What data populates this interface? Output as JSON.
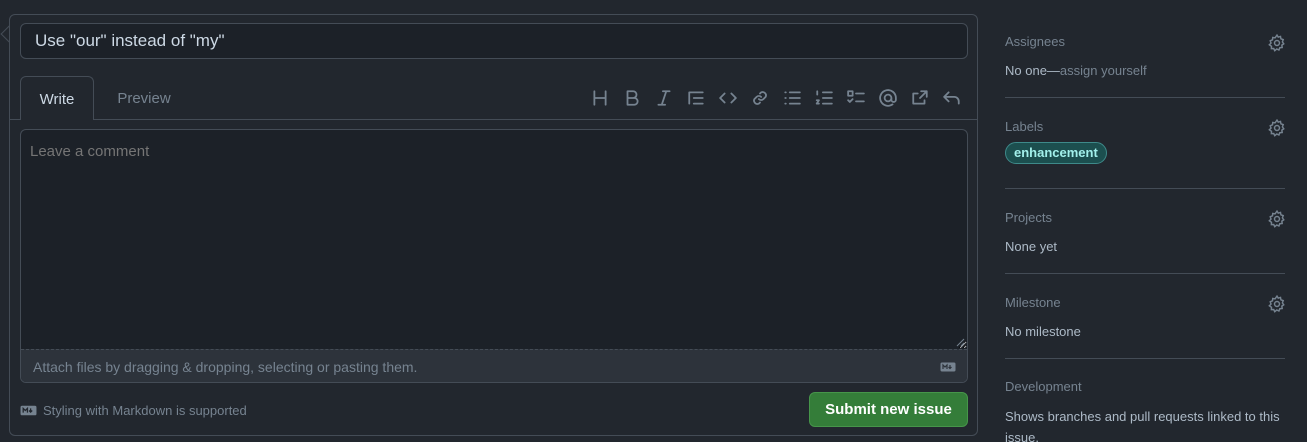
{
  "issue": {
    "title_value": "Use \"our\" instead of \"my\"",
    "tabs": [
      {
        "label": "Write"
      },
      {
        "label": "Preview"
      }
    ],
    "comment_placeholder": "Leave a comment",
    "attach_text": "Attach files by dragging & dropping, selecting or pasting them.",
    "markdown_note": "Styling with Markdown is supported",
    "submit_label": "Submit new issue",
    "toolbar_icons": [
      "heading-icon",
      "bold-icon",
      "italic-icon",
      "quote-icon",
      "code-icon",
      "link-icon",
      "unordered-list-icon",
      "ordered-list-icon",
      "task-list-icon",
      "mention-icon",
      "reference-icon",
      "undo-icon"
    ]
  },
  "sidebar": {
    "assignees": {
      "heading": "Assignees",
      "value_prefix": "No one—",
      "value_link": "assign yourself"
    },
    "labels": {
      "heading": "Labels",
      "items": [
        {
          "name": "enhancement",
          "color": "#a2eeef"
        }
      ]
    },
    "projects": {
      "heading": "Projects",
      "value": "None yet"
    },
    "milestone": {
      "heading": "Milestone",
      "value": "No milestone"
    },
    "development": {
      "heading": "Development",
      "value": "Shows branches and pull requests linked to this issue."
    }
  },
  "colors": {
    "background": "#22272e",
    "border": "#444c56",
    "submit": "#347d39",
    "muted": "#768390"
  }
}
